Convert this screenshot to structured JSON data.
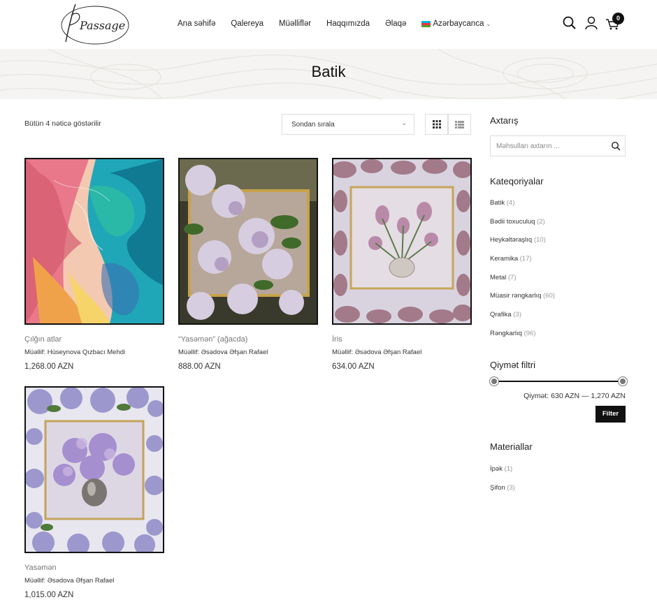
{
  "header": {
    "logo_text": "Passage",
    "nav": [
      {
        "label": "Ana səhifə"
      },
      {
        "label": "Qalereya"
      },
      {
        "label": "Müəlliflər"
      },
      {
        "label": "Haqqımızda"
      },
      {
        "label": "Əlaqə"
      }
    ],
    "language": "Azərbaycanca",
    "cart_count": "0"
  },
  "banner": {
    "title": "Batik"
  },
  "toolbar": {
    "result_count": "Bütün 4 nəticə göstərilir",
    "sort_label": "Sondan sırala"
  },
  "products": [
    {
      "name": "Çılğın atlar",
      "author": "Müəllif: Hüseynova Qızbacı Mehdi",
      "price": "1,268.00 AZN"
    },
    {
      "name": "“Yasəmən” (ağacda)",
      "author": "Müəllif: Əsədova Əfşan Rafael",
      "price": "888.00 AZN"
    },
    {
      "name": "İris",
      "author": "Müəllif: Əsədova Əfşan Rafael",
      "price": "634.00 AZN"
    },
    {
      "name": "Yasəmən",
      "author": "Müəllif: Əsədova Əfşan Rafael",
      "price": "1,015.00 AZN"
    }
  ],
  "sidebar": {
    "search_title": "Axtarış",
    "search_placeholder": "Məhsulları axtarın ...",
    "categories_title": "Kateqoriyalar",
    "categories": [
      {
        "label": "Batik",
        "count": "(4)"
      },
      {
        "label": "Bədii toxuculuq",
        "count": "(2)"
      },
      {
        "label": "Heykəltəraşlıq",
        "count": "(10)"
      },
      {
        "label": "Keramika",
        "count": "(17)"
      },
      {
        "label": "Metal",
        "count": "(7)"
      },
      {
        "label": "Müasir rəngkarlıq",
        "count": "(60)"
      },
      {
        "label": "Qrafika",
        "count": "(3)"
      },
      {
        "label": "Rəngkarlıq",
        "count": "(96)"
      }
    ],
    "price_title": "Qiymət filtri",
    "price_range": "Qiymət: 630 AZN — 1,270 AZN",
    "price_min": 630,
    "price_max": 1270,
    "filter_label": "Filter",
    "materials_title": "Materiallar",
    "materials": [
      {
        "label": "İpək",
        "count": "(1)"
      },
      {
        "label": "Şifon",
        "count": "(3)"
      }
    ]
  },
  "colors": {
    "accent": "#111111",
    "banner_bg": "#f5f4f2",
    "muted_text": "#777777"
  }
}
